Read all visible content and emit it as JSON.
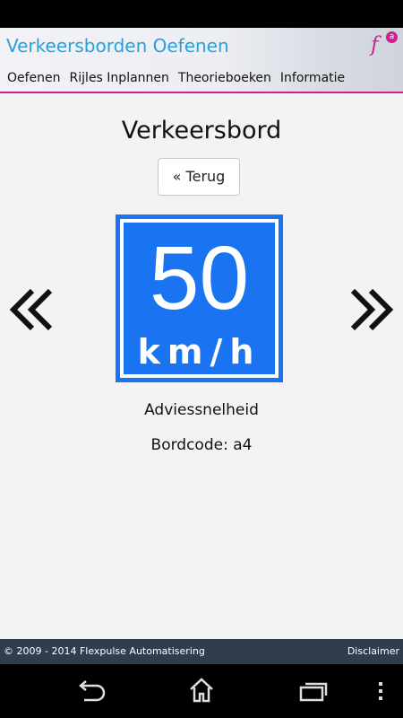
{
  "header": {
    "title": "Verkeersborden Oefenen",
    "logo": {
      "letter": "f",
      "badge": "a"
    },
    "nav": [
      "Oefenen",
      "Rijles Inplannen",
      "Theorieboeken",
      "Informatie"
    ]
  },
  "main": {
    "title": "Verkeersbord",
    "back_button": "« Terug",
    "sign": {
      "number": "50",
      "unit": "km/h"
    },
    "sign_name": "Adviessnelheid",
    "sign_code": "Bordcode: a4"
  },
  "footer": {
    "copyright": "© 2009 - 2014 Flexpulse Automatisering",
    "disclaimer": "Disclaimer"
  },
  "colors": {
    "accent": "#2a9fd9",
    "brand": "#d21f8d",
    "sign_blue": "#1a73f0",
    "footer_bg": "#2f3d4d"
  },
  "icons": [
    "previous-sign-icon",
    "next-sign-icon",
    "back-icon",
    "home-icon",
    "recent-apps-icon",
    "overflow-menu-icon"
  ]
}
